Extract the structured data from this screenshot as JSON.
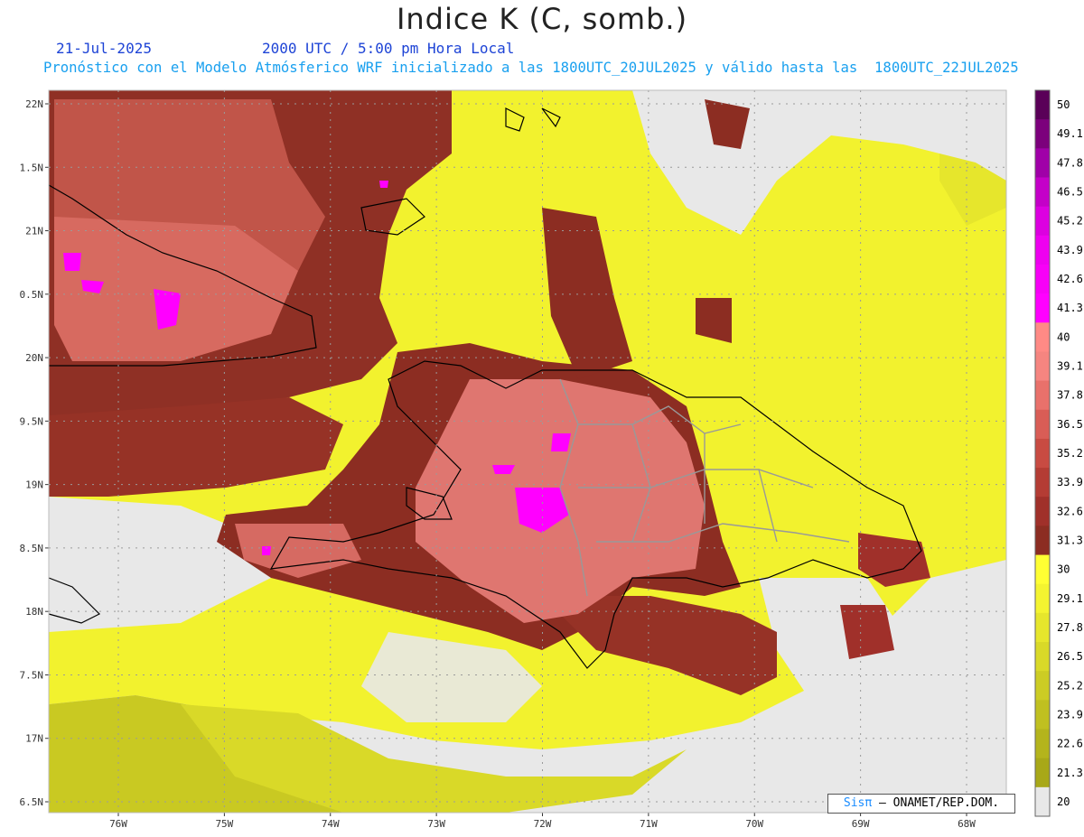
{
  "header": {
    "title": "Indice K (C, somb.)",
    "date": "21-Jul-2025",
    "time": "2000 UTC / 5:00 pm Hora Local",
    "forecast": "Pronóstico con el Modelo Atmósferico WRF inicializado a las 1800UTC_20JUL2025 y válido hasta las  1800UTC_22JUL2025"
  },
  "map": {
    "lat_labels": [
      "22N",
      "1.5N",
      "21N",
      "0.5N",
      "20N",
      "9.5N",
      "19N",
      "8.5N",
      "18N",
      "7.5N",
      "17N",
      "6.5N"
    ],
    "lon_labels": [
      "76W",
      "75W",
      "74W",
      "73W",
      "72W",
      "71W",
      "70W",
      "69W",
      "68W"
    ]
  },
  "legend": {
    "values": [
      "50",
      "49.1",
      "47.8",
      "46.5",
      "45.2",
      "43.9",
      "42.6",
      "41.3",
      "40",
      "39.1",
      "37.8",
      "36.5",
      "35.2",
      "33.9",
      "32.6",
      "31.3",
      "30",
      "29.1",
      "27.8",
      "26.5",
      "25.2",
      "23.9",
      "22.6",
      "21.3",
      "20"
    ],
    "colors": [
      "#5a0058",
      "#7c007c",
      "#a000a8",
      "#c400c8",
      "#dc00e0",
      "#ee00f0",
      "#f700f7",
      "#ff00ff",
      "#ff8a85",
      "#f58580",
      "#e9716b",
      "#d95d56",
      "#c84b42",
      "#b43c34",
      "#a0302a",
      "#8c2d22",
      "#ffff33",
      "#f4f430",
      "#e6e62c",
      "#d9d928",
      "#cccc24",
      "#c0c020",
      "#b4b41c",
      "#a8a818",
      "#e8e8e8"
    ]
  },
  "credit": {
    "brand": "Sisπ",
    "text": "– ONAMET/REP.DOM."
  }
}
